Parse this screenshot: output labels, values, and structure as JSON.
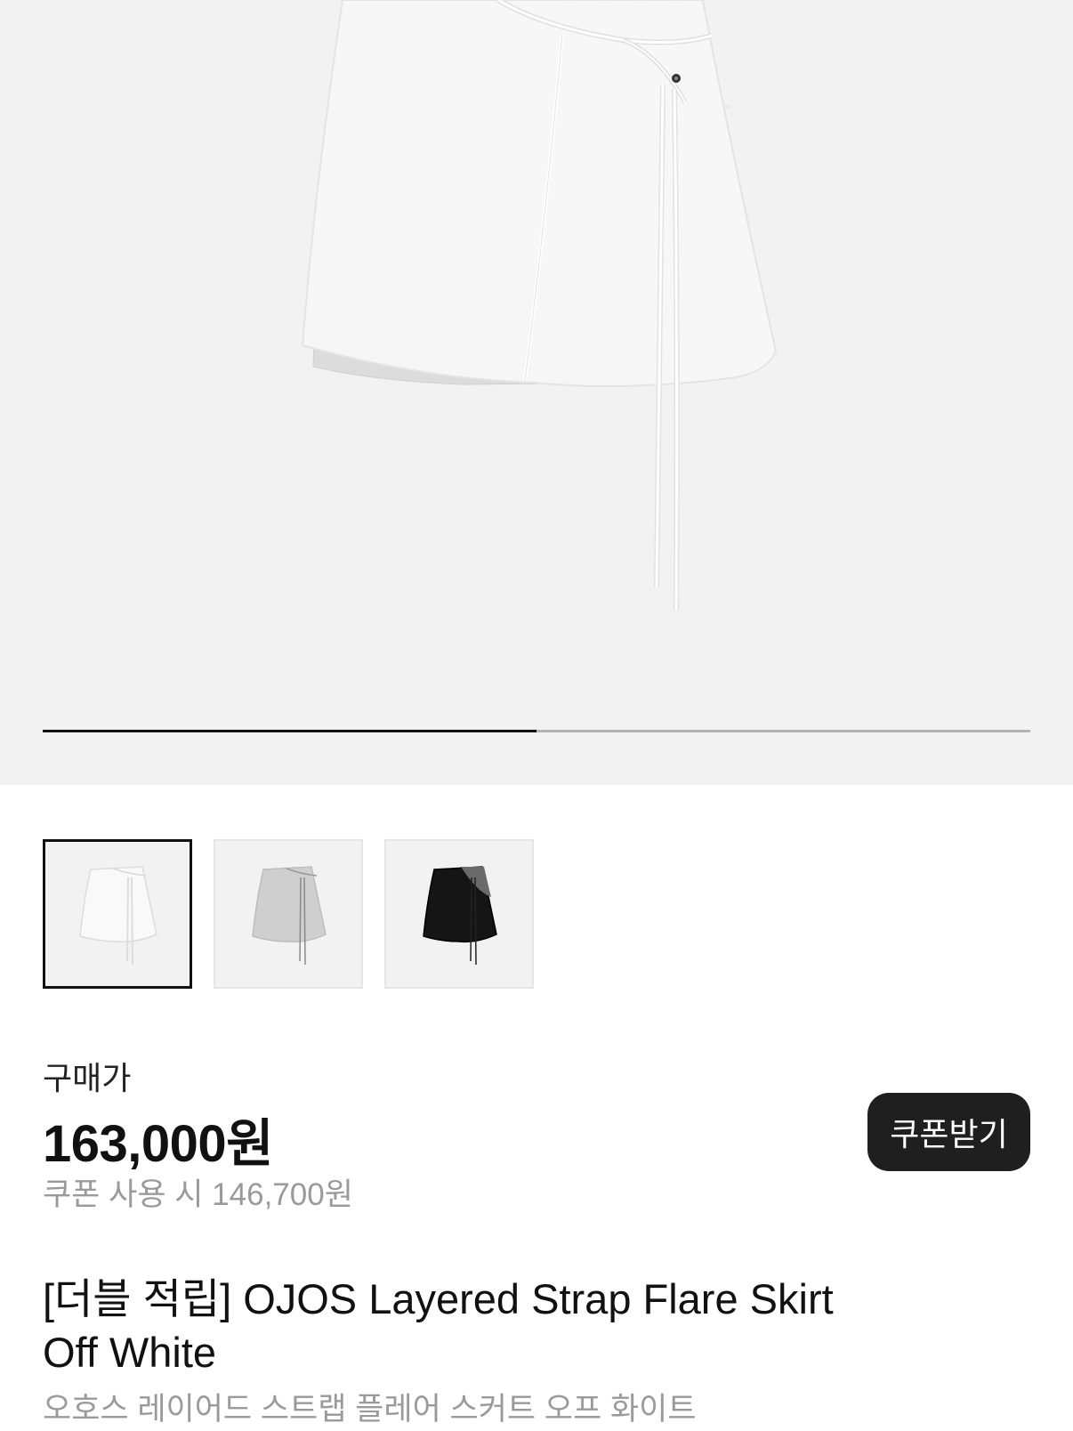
{
  "gallery": {
    "current_index": 1,
    "total": 2,
    "progress_fraction": 0.5
  },
  "thumbnails": [
    {
      "name": "thumb-off-white",
      "colorway": "off-white",
      "selected": true
    },
    {
      "name": "thumb-grey",
      "colorway": "grey",
      "selected": false
    },
    {
      "name": "thumb-black",
      "colorway": "black",
      "selected": false
    }
  ],
  "price": {
    "label": "구매가",
    "amount": "163,000원",
    "coupon_text": "쿠폰 사용 시 146,700원",
    "coupon_button": "쿠폰받기"
  },
  "product": {
    "title_line1": "[더블 적립] OJOS Layered Strap Flare Skirt",
    "title_line2": "Off White",
    "korean_name": "오호스 레이어드 스트랩 플레어 스커트 오프 화이트"
  },
  "colors": {
    "hero_bg": "#f2f2f2",
    "button_bg": "#1f1f1f",
    "muted_text": "#9a9a9a",
    "progress_active": "#111111",
    "progress_track": "#b4b4b4"
  }
}
